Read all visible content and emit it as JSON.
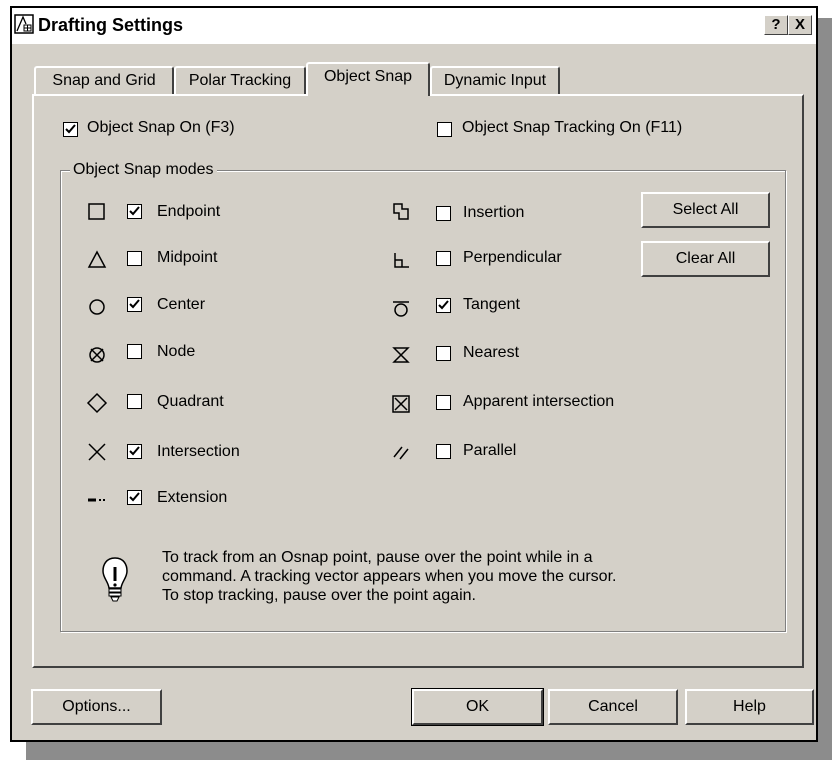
{
  "window": {
    "title": "Drafting Settings",
    "help_btn": "?",
    "close_btn": "X"
  },
  "tabs": [
    {
      "label": "Snap and Grid",
      "active": false
    },
    {
      "label": "Polar Tracking",
      "active": false
    },
    {
      "label": "Object Snap",
      "active": true
    },
    {
      "label": "Dynamic Input",
      "active": false
    }
  ],
  "options": {
    "osnap_on": {
      "label": "Object Snap On (F3)",
      "checked": true
    },
    "tracking_on": {
      "label": "Object Snap Tracking On (F11)",
      "checked": false
    }
  },
  "group": {
    "title": "Object Snap modes"
  },
  "modes_left": [
    {
      "label": "Endpoint",
      "checked": true,
      "icon": "endpoint-icon"
    },
    {
      "label": "Midpoint",
      "checked": false,
      "icon": "midpoint-icon"
    },
    {
      "label": "Center",
      "checked": true,
      "icon": "center-icon"
    },
    {
      "label": "Node",
      "checked": false,
      "icon": "node-icon"
    },
    {
      "label": "Quadrant",
      "checked": false,
      "icon": "quadrant-icon"
    },
    {
      "label": "Intersection",
      "checked": true,
      "icon": "intersection-icon"
    },
    {
      "label": "Extension",
      "checked": true,
      "icon": "extension-icon"
    }
  ],
  "modes_right": [
    {
      "label": "Insertion",
      "checked": false,
      "icon": "insertion-icon"
    },
    {
      "label": "Perpendicular",
      "checked": false,
      "icon": "perpendicular-icon"
    },
    {
      "label": "Tangent",
      "checked": true,
      "icon": "tangent-icon"
    },
    {
      "label": "Nearest",
      "checked": false,
      "icon": "nearest-icon"
    },
    {
      "label": "Apparent intersection",
      "checked": false,
      "icon": "apparent-intersection-icon"
    },
    {
      "label": "Parallel",
      "checked": false,
      "icon": "parallel-icon"
    }
  ],
  "buttons": {
    "select_all": "Select All",
    "clear_all": "Clear All",
    "options": "Options...",
    "ok": "OK",
    "cancel": "Cancel",
    "help": "Help"
  },
  "hint": {
    "line1": "To track from an Osnap point, pause over the point while in a",
    "line2": "command.  A tracking vector appears when you move the cursor.",
    "line3": "To stop tracking, pause over the point again.",
    "icon": "lightbulb-icon"
  }
}
